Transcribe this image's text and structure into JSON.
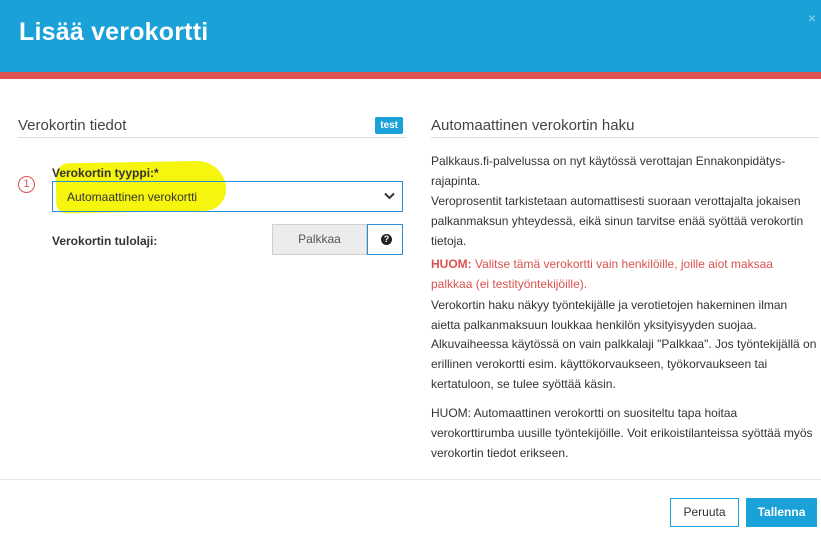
{
  "dialog": {
    "title": "Lisää verokortti",
    "close_glyph": "×",
    "close_icon": "close-icon"
  },
  "left": {
    "section_title": "Verokortin tiedot",
    "badge": "test",
    "step_number": "1",
    "type_label": "Verokortin tyyppi:*",
    "type_selected": "Automaattinen verokortti",
    "income_label": "Verokortin tulolaji:",
    "income_value": "Palkkaa",
    "help_glyph": "?",
    "help_icon": "question-circle-icon"
  },
  "right": {
    "section_title": "Automaattinen verokortin haku",
    "paragraphs": [
      "Palkkaus.fi-palvelussa on nyt käytössä verottajan Ennakonpidätys-rajapinta.",
      "Veroprosentit tarkistetaan automattisesti suoraan verottajalta jokaisen palkanmaksun yhteydessä, eikä sinun tarvitse enää syöttää verokortin tietoja.",
      "Verokortin haku näkyy työntekijälle ja verotietojen hakeminen ilman aietta palkanmaksuun loukkaa henkilön yksityisyyden suojaa.",
      "Alkuvaiheessa käytössä on vain palkkalaji \"Palkkaa\". Jos työntekijällä on erillinen verokortti esim. käyttökorvaukseen, työkorvaukseen tai kertatuloon, se tulee syöttää käsin.",
      "HUOM: Automaattinen verokortti on suositeltu tapa hoitaa verokorttirumba uusille työntekijöille. Voit erikoistilanteissa syöttää myös verokortin tiedot erikseen."
    ],
    "warning_prefix": "HUOM:",
    "warning_text": "Valitse tämä verokortti vain henkilöille, joille aiot maksaa palkkaa (ei testityöntekijöille).",
    "warning_color": "#d9534f"
  },
  "footer": {
    "cancel_label": "Peruuta",
    "save_label": "Tallenna"
  },
  "colors": {
    "header": "#1aa1d8",
    "header_stripe": "#d9534f",
    "highlight": "#f4f400",
    "accent": "#1aa1d8"
  }
}
